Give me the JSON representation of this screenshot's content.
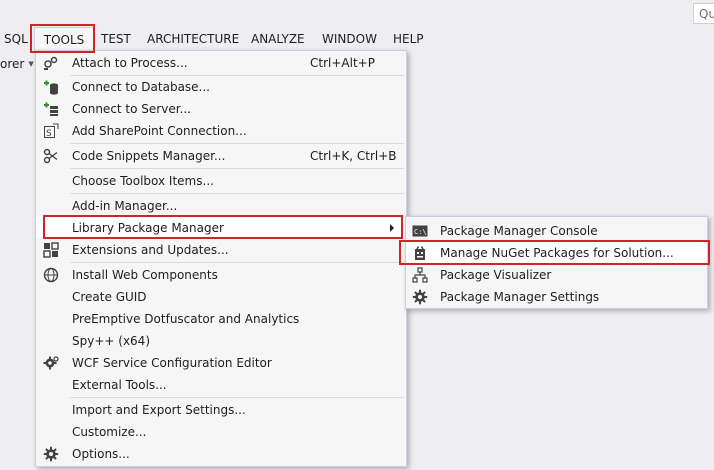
{
  "quick_launch": {
    "text": "Qu"
  },
  "left_stub": {
    "text": "orer"
  },
  "menubar": {
    "items": [
      {
        "label": "SQL"
      },
      {
        "label": "TOOLS"
      },
      {
        "label": "TEST"
      },
      {
        "label": "ARCHITECTURE"
      },
      {
        "label": "ANALYZE"
      },
      {
        "label": "WINDOW"
      },
      {
        "label": "HELP"
      }
    ]
  },
  "tools_menu": {
    "items": [
      {
        "label": "Attach to Process...",
        "shortcut": "Ctrl+Alt+P",
        "icon": "attach-process-icon"
      },
      {
        "label": "Connect to Database...",
        "shortcut": "",
        "icon": "connect-database-icon"
      },
      {
        "label": "Connect to Server...",
        "shortcut": "",
        "icon": "connect-server-icon"
      },
      {
        "label": "Add SharePoint Connection...",
        "shortcut": "",
        "icon": "sharepoint-icon"
      },
      {
        "label": "Code Snippets Manager...",
        "shortcut": "Ctrl+K, Ctrl+B",
        "icon": "code-snippets-icon"
      },
      {
        "label": "Choose Toolbox Items...",
        "shortcut": "",
        "icon": ""
      },
      {
        "label": "Add-in Manager...",
        "shortcut": "",
        "icon": ""
      },
      {
        "label": "Library Package Manager",
        "shortcut": "",
        "icon": ""
      },
      {
        "label": "Extensions and Updates...",
        "shortcut": "",
        "icon": "extensions-icon"
      },
      {
        "label": "Install Web Components",
        "shortcut": "",
        "icon": "web-components-icon"
      },
      {
        "label": "Create GUID",
        "shortcut": "",
        "icon": ""
      },
      {
        "label": "PreEmptive Dotfuscator and Analytics",
        "shortcut": "",
        "icon": ""
      },
      {
        "label": "Spy++ (x64)",
        "shortcut": "",
        "icon": ""
      },
      {
        "label": "WCF Service Configuration Editor",
        "shortcut": "",
        "icon": "wcf-gear-icon"
      },
      {
        "label": "External Tools...",
        "shortcut": "",
        "icon": ""
      },
      {
        "label": "Import and Export Settings...",
        "shortcut": "",
        "icon": ""
      },
      {
        "label": "Customize...",
        "shortcut": "",
        "icon": ""
      },
      {
        "label": "Options...",
        "shortcut": "",
        "icon": "options-gear-icon"
      }
    ]
  },
  "package_submenu": {
    "items": [
      {
        "label": "Package Manager Console",
        "icon": "console-icon"
      },
      {
        "label": "Manage NuGet Packages for Solution...",
        "icon": "nuget-package-icon"
      },
      {
        "label": "Package Visualizer",
        "icon": "visualizer-icon"
      },
      {
        "label": "Package Manager Settings",
        "icon": "settings-gear-icon"
      }
    ]
  },
  "colors": {
    "highlight": "#d2232a",
    "menu_bg": "#f6f6f6",
    "app_bg": "#eeeef2"
  }
}
